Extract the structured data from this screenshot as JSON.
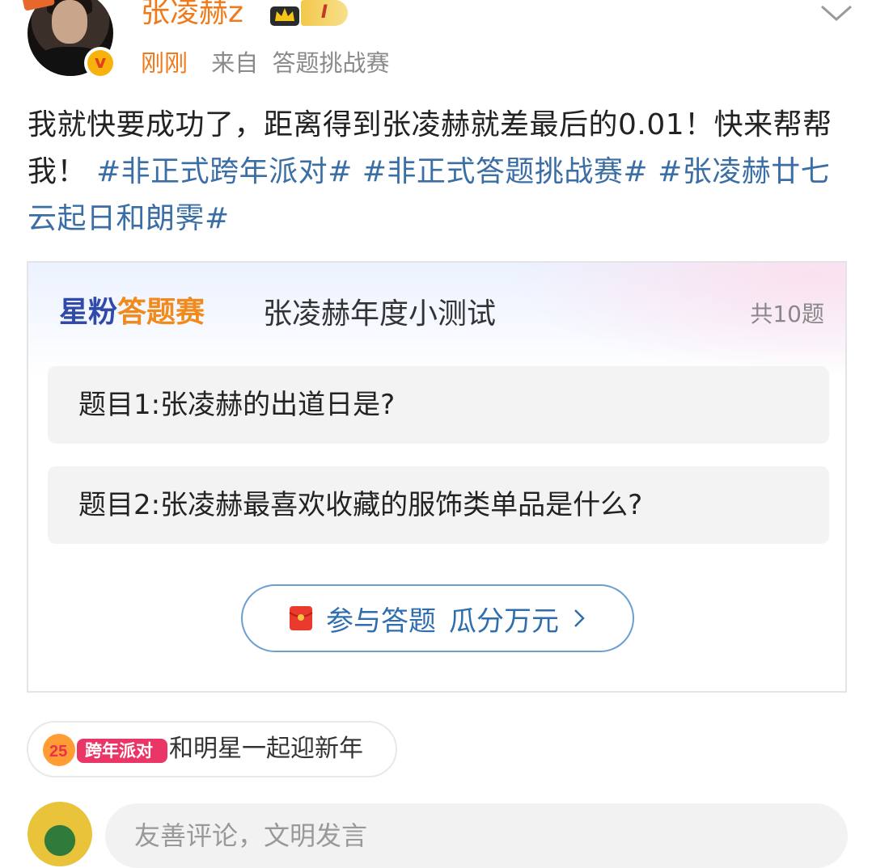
{
  "post": {
    "username": "张凌赫z",
    "level": "I",
    "time": "刚刚",
    "from_label": "来自",
    "source": "答题挑战赛",
    "text": "我就快要成功了，距离得到张凌赫就差最后的0.01！快来帮帮我！",
    "tags": [
      "#非正式跨年派对#",
      "#非正式答题挑战赛#",
      "#张凌赫廿七云起日和朗霁#"
    ]
  },
  "card": {
    "brand_part1": "星粉",
    "brand_part2": "答题赛",
    "title": "张凌赫年度小测试",
    "count": "共10题",
    "questions": [
      "题目1:张凌赫的出道日是?",
      "题目2:张凌赫最喜欢收藏的服饰类单品是什么?"
    ],
    "cta_label": "参与答题",
    "cta_reward": "瓜分万元"
  },
  "topic": {
    "logo_text": "跨年派对",
    "label": "和明星一起迎新年"
  },
  "comment": {
    "placeholder": "友善评论，文明发言"
  },
  "colors": {
    "username": "#f07a1a",
    "tag": "#3a6ea5",
    "cta": "#2f6eae"
  }
}
